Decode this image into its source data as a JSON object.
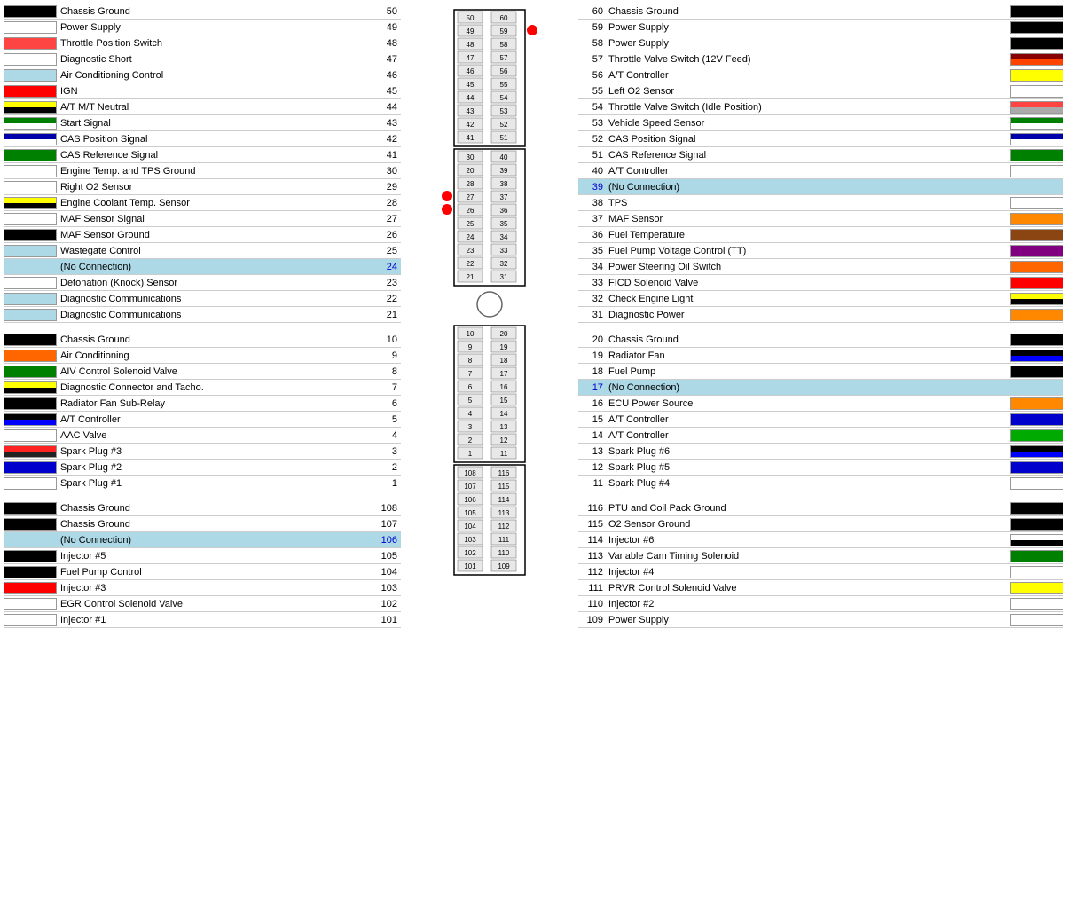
{
  "left": {
    "rows_top": [
      {
        "num": "50",
        "label": "Chassis Ground",
        "color": "#000000",
        "noconn": false
      },
      {
        "num": "49",
        "label": "Power Supply",
        "color": "#ffffff",
        "noconn": false
      },
      {
        "num": "48",
        "label": "Throttle Position Switch",
        "color": "#ff4444",
        "noconn": false,
        "stripe": "#ff8800"
      },
      {
        "num": "47",
        "label": "Diagnostic Short",
        "color": "#ffffff",
        "noconn": false
      },
      {
        "num": "46",
        "label": "Air Conditioning Control",
        "color": "#add8e6",
        "noconn": false
      },
      {
        "num": "45",
        "label": "IGN",
        "color": "#ff0000",
        "noconn": false
      },
      {
        "num": "44",
        "label": "A/T M/T Neutral",
        "color": "#ffff00",
        "noconn": false,
        "stripe2": "#000"
      },
      {
        "num": "43",
        "label": "Start Signal",
        "color": "#008000",
        "noconn": false,
        "stripe2": "#fff"
      },
      {
        "num": "42",
        "label": "CAS Position Signal",
        "color": "#0000aa",
        "noconn": false,
        "stripe2": "#fff"
      },
      {
        "num": "41",
        "label": "CAS Reference Signal",
        "color": "#008000",
        "noconn": false
      },
      {
        "num": "30",
        "label": "Engine Temp. and TPS Ground",
        "color": "#ffffff",
        "noconn": false
      },
      {
        "num": "29",
        "label": "Right O2 Sensor",
        "color": "#ffffff",
        "noconn": false
      },
      {
        "num": "28",
        "label": "Engine Coolant Temp. Sensor",
        "color": "#ffff00",
        "noconn": false,
        "stripe2": "#000"
      },
      {
        "num": "27",
        "label": "MAF Sensor Signal",
        "color": "#ffffff",
        "noconn": false
      },
      {
        "num": "26",
        "label": "MAF Sensor Ground",
        "color": "#000000",
        "noconn": false
      },
      {
        "num": "25",
        "label": "Wastegate Control",
        "color": "#add8e6",
        "noconn": false
      },
      {
        "num": "24",
        "label": "(No Connection)",
        "color": "transparent",
        "noconn": true
      },
      {
        "num": "23",
        "label": "Detonation (Knock) Sensor",
        "color": "#ffffff",
        "noconn": false
      },
      {
        "num": "22",
        "label": "Diagnostic Communications",
        "color": "#add8e6",
        "noconn": false
      },
      {
        "num": "21",
        "label": "Diagnostic Communications",
        "color": "#add8e6",
        "noconn": false
      }
    ],
    "rows_mid": [
      {
        "num": "10",
        "label": "Chassis Ground",
        "color": "#000000",
        "noconn": false
      },
      {
        "num": "9",
        "label": "Air Conditioning",
        "color": "#ff6600",
        "noconn": false
      },
      {
        "num": "8",
        "label": "AIV Control Solenoid Valve",
        "color": "#008000",
        "noconn": false
      },
      {
        "num": "7",
        "label": "Diagnostic Connector and Tacho.",
        "color": "#ffff00",
        "noconn": false,
        "stripe2": "#000"
      },
      {
        "num": "6",
        "label": "Radiator Fan Sub-Relay",
        "color": "#000000",
        "noconn": false
      },
      {
        "num": "5",
        "label": "A/T Controller",
        "color": "#000000",
        "noconn": false,
        "stripe2": "#00f"
      },
      {
        "num": "4",
        "label": "AAC Valve",
        "color": "#ffffff",
        "noconn": false
      },
      {
        "num": "3",
        "label": "Spark Plug #3",
        "color": "#ff2222",
        "noconn": false,
        "stripe2": "#222"
      },
      {
        "num": "2",
        "label": "Spark Plug #2",
        "color": "#0000cc",
        "noconn": false
      },
      {
        "num": "1",
        "label": "Spark Plug #1",
        "color": "#ffffff",
        "noconn": false
      }
    ],
    "rows_bot": [
      {
        "num": "108",
        "label": "Chassis Ground",
        "color": "#000000",
        "noconn": false
      },
      {
        "num": "107",
        "label": "Chassis Ground",
        "color": "#000000",
        "noconn": false
      },
      {
        "num": "106",
        "label": "(No Connection)",
        "color": "transparent",
        "noconn": true
      },
      {
        "num": "105",
        "label": "Injector #5",
        "color": "#000000",
        "noconn": false
      },
      {
        "num": "104",
        "label": "Fuel Pump Control",
        "color": "#000000",
        "noconn": false
      },
      {
        "num": "103",
        "label": "Injector #3",
        "color": "#ff0000",
        "noconn": false
      },
      {
        "num": "102",
        "label": "EGR Control Solenoid Valve",
        "color": "#ffffff",
        "noconn": false
      },
      {
        "num": "101",
        "label": "Injector #1",
        "color": "#ffffff",
        "noconn": false
      }
    ]
  },
  "right": {
    "rows_top": [
      {
        "num": "60",
        "label": "Chassis Ground",
        "color": "#000000",
        "noconn": false
      },
      {
        "num": "59",
        "label": "Power Supply",
        "color": "#000000",
        "noconn": false
      },
      {
        "num": "58",
        "label": "Power Supply",
        "color": "#000000",
        "noconn": false
      },
      {
        "num": "57",
        "label": "Throttle Valve Switch (12V Feed)",
        "color": "#880000",
        "noconn": false,
        "stripe2": "#ff4400"
      },
      {
        "num": "56",
        "label": "A/T Controller",
        "color": "#ffff00",
        "noconn": false
      },
      {
        "num": "55",
        "label": "Left O2 Sensor",
        "color": "#ffffff",
        "noconn": false
      },
      {
        "num": "54",
        "label": "Throttle Valve Switch (Idle Position)",
        "color": "#ff4444",
        "noconn": false,
        "stripe2": "#aaa"
      },
      {
        "num": "53",
        "label": "Vehicle Speed Sensor",
        "color": "#008000",
        "noconn": false,
        "stripe2": "#fff"
      },
      {
        "num": "52",
        "label": "CAS Position Signal",
        "color": "#0000aa",
        "noconn": false,
        "stripe2": "#fff"
      },
      {
        "num": "51",
        "label": "CAS Reference Signal",
        "color": "#008000",
        "noconn": false
      },
      {
        "num": "40",
        "label": "A/T Controller",
        "color": "#ffffff",
        "noconn": false
      },
      {
        "num": "39",
        "label": "(No Connection)",
        "color": "transparent",
        "noconn": true
      },
      {
        "num": "38",
        "label": "TPS",
        "color": "#ffffff",
        "noconn": false
      },
      {
        "num": "37",
        "label": "MAF Sensor",
        "color": "#ff8800",
        "noconn": false
      },
      {
        "num": "36",
        "label": "Fuel Temperature",
        "color": "#8B4513",
        "noconn": false
      },
      {
        "num": "35",
        "label": "Fuel Pump Voltage Control (TT)",
        "color": "#800080",
        "noconn": false
      },
      {
        "num": "34",
        "label": "Power Steering Oil Switch",
        "color": "#ff6600",
        "noconn": false
      },
      {
        "num": "33",
        "label": "FICD Solenoid Valve",
        "color": "#ff0000",
        "noconn": false
      },
      {
        "num": "32",
        "label": "Check Engine Light",
        "color": "#ffff00",
        "noconn": false,
        "stripe2": "#000"
      },
      {
        "num": "31",
        "label": "Diagnostic Power",
        "color": "#ff8800",
        "noconn": false
      }
    ],
    "rows_mid": [
      {
        "num": "20",
        "label": "Chassis Ground",
        "color": "#000000",
        "noconn": false
      },
      {
        "num": "19",
        "label": "Radiator Fan",
        "color": "#000000",
        "noconn": false,
        "stripe2": "#00f"
      },
      {
        "num": "18",
        "label": "Fuel Pump",
        "color": "#000000",
        "noconn": false
      },
      {
        "num": "17",
        "label": "(No Connection)",
        "color": "transparent",
        "noconn": true
      },
      {
        "num": "16",
        "label": "ECU Power Source",
        "color": "#ff8800",
        "noconn": false
      },
      {
        "num": "15",
        "label": "A/T Controller",
        "color": "#0000cc",
        "noconn": false
      },
      {
        "num": "14",
        "label": "A/T Controller",
        "color": "#00aa00",
        "noconn": false
      },
      {
        "num": "13",
        "label": "Spark Plug #6",
        "color": "#000000",
        "noconn": false,
        "stripe2": "#00f"
      },
      {
        "num": "12",
        "label": "Spark Plug #5",
        "color": "#0000cc",
        "noconn": false
      },
      {
        "num": "11",
        "label": "Spark Plug #4",
        "color": "#ffffff",
        "noconn": false
      }
    ],
    "rows_bot": [
      {
        "num": "116",
        "label": "PTU and Coil Pack Ground",
        "color": "#000000",
        "noconn": false
      },
      {
        "num": "115",
        "label": "O2 Sensor Ground",
        "color": "#000000",
        "noconn": false
      },
      {
        "num": "114",
        "label": "Injector #6",
        "color": "#ffffff",
        "noconn": false,
        "stripe2": "#000"
      },
      {
        "num": "113",
        "label": "Variable Cam Timing Solenoid",
        "color": "#008000",
        "noconn": false
      },
      {
        "num": "112",
        "label": "Injector #4",
        "color": "#ffffff",
        "noconn": false
      },
      {
        "num": "111",
        "label": "PRVR Control Solenoid Valve",
        "color": "#ffff00",
        "noconn": false
      },
      {
        "num": "110",
        "label": "Injector #2",
        "color": "#ffffff",
        "noconn": false
      },
      {
        "num": "109",
        "label": "Power Supply",
        "color": "#ffffff",
        "noconn": false
      }
    ]
  },
  "connector": {
    "top_pairs": [
      [
        "50",
        "60"
      ],
      [
        "49",
        "59"
      ],
      [
        "48",
        "58"
      ],
      [
        "47",
        "57"
      ],
      [
        "46",
        "56"
      ],
      [
        "45",
        "55"
      ],
      [
        "44",
        "54"
      ],
      [
        "43",
        "53"
      ],
      [
        "42",
        "52"
      ],
      [
        "41",
        "51"
      ]
    ],
    "mid_pairs": [
      [
        "30",
        "40"
      ],
      [
        "20",
        "39"
      ],
      [
        "28",
        "38"
      ],
      [
        "27",
        "37"
      ],
      [
        "26",
        "36"
      ],
      [
        "25",
        "35"
      ],
      [
        "24",
        "34"
      ],
      [
        "23",
        "33"
      ],
      [
        "22",
        "32"
      ],
      [
        "21",
        "31"
      ]
    ],
    "lower_pairs": [
      [
        "10",
        "20"
      ],
      [
        "9",
        "19"
      ],
      [
        "8",
        "18"
      ],
      [
        "7",
        "17"
      ],
      [
        "6",
        "16"
      ],
      [
        "5",
        "15"
      ],
      [
        "4",
        "14"
      ],
      [
        "3",
        "13"
      ],
      [
        "2",
        "12"
      ],
      [
        "1",
        "11"
      ]
    ],
    "bottom_pairs": [
      [
        "108",
        "116"
      ],
      [
        "107",
        "115"
      ],
      [
        "106",
        "114"
      ],
      [
        "105",
        "113"
      ],
      [
        "104",
        "112"
      ],
      [
        "103",
        "111"
      ],
      [
        "102",
        "110"
      ],
      [
        "101",
        "109"
      ]
    ]
  }
}
